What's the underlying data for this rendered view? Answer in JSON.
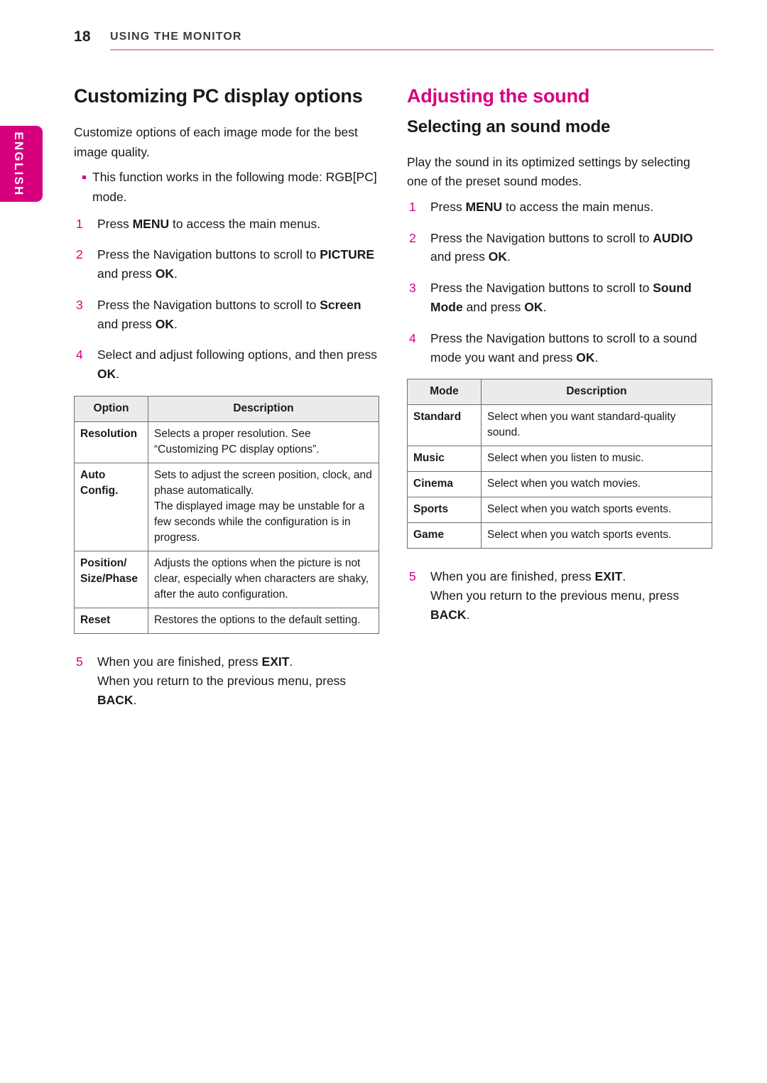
{
  "header": {
    "page_number": "18",
    "title": "USING THE MONITOR"
  },
  "language_tab": {
    "label": "ENGLISH"
  },
  "colors": {
    "accent": "#d6007f",
    "rule": "#ef8ec0",
    "table_header_bg": "#ebebeb",
    "table_border": "#6e6e6e"
  },
  "left_column": {
    "title": "Customizing PC display options",
    "intro": "Customize options of each image mode for the best image quality.",
    "notes": [
      "This function works in the following mode: RGB[PC] mode."
    ],
    "steps": [
      {
        "num": "1",
        "parts": [
          {
            "text": "Press ",
            "bold": false
          },
          {
            "text": "MENU",
            "bold": true
          },
          {
            "text": " to access the main menus.",
            "bold": false
          }
        ]
      },
      {
        "num": "2",
        "parts": [
          {
            "text": "Press the Navigation buttons to scroll to ",
            "bold": false
          },
          {
            "text": "PICTURE",
            "bold": true
          },
          {
            "text": " and press ",
            "bold": false
          },
          {
            "text": "OK",
            "bold": true
          },
          {
            "text": ".",
            "bold": false
          }
        ]
      },
      {
        "num": "3",
        "parts": [
          {
            "text": "Press the Navigation buttons to scroll to ",
            "bold": false
          },
          {
            "text": "Screen",
            "bold": true
          },
          {
            "text": " and press ",
            "bold": false
          },
          {
            "text": "OK",
            "bold": true
          },
          {
            "text": ".",
            "bold": false
          }
        ]
      },
      {
        "num": "4",
        "parts": [
          {
            "text": "Select and adjust following options, and then press ",
            "bold": false
          },
          {
            "text": "OK",
            "bold": true
          },
          {
            "text": ".",
            "bold": false
          }
        ]
      }
    ],
    "table": {
      "headers": [
        "Option",
        "Description"
      ],
      "rows": [
        {
          "key": "Resolution",
          "desc": "Selects a proper resolution. See “Customizing PC display options”."
        },
        {
          "key": "Auto Config.",
          "desc": "Sets to adjust the screen position, clock, and phase automatically.\nThe displayed image may be unstable for a few seconds while the configuration is in progress."
        },
        {
          "key": "Position/ Size/Phase",
          "desc": "Adjusts the options when the picture is not clear, especially when characters are shaky, after the auto configuration."
        },
        {
          "key": "Reset",
          "desc": "Restores the options to the default setting."
        }
      ]
    },
    "final_step": {
      "num": "5",
      "parts": [
        {
          "text": "When you are finished, press ",
          "bold": false
        },
        {
          "text": "EXIT",
          "bold": true
        },
        {
          "text": ".",
          "bold": false
        }
      ],
      "tail_parts": [
        {
          "text": "When you return to the previous menu, press ",
          "bold": false
        },
        {
          "text": "BACK",
          "bold": true
        },
        {
          "text": ".",
          "bold": false
        }
      ]
    }
  },
  "right_column": {
    "title": "Adjusting the sound",
    "subtitle": "Selecting an sound mode",
    "intro": "Play the sound in its optimized settings by selecting one of the preset sound modes.",
    "steps": [
      {
        "num": "1",
        "parts": [
          {
            "text": "Press ",
            "bold": false
          },
          {
            "text": "MENU",
            "bold": true
          },
          {
            "text": " to access the main menus.",
            "bold": false
          }
        ]
      },
      {
        "num": "2",
        "parts": [
          {
            "text": "Press the Navigation buttons to scroll to ",
            "bold": false
          },
          {
            "text": "AUDIO",
            "bold": true
          },
          {
            "text": " and press ",
            "bold": false
          },
          {
            "text": "OK",
            "bold": true
          },
          {
            "text": ".",
            "bold": false
          }
        ]
      },
      {
        "num": "3",
        "parts": [
          {
            "text": "Press the Navigation buttons to scroll to ",
            "bold": false
          },
          {
            "text": "Sound Mode",
            "bold": true
          },
          {
            "text": " and press ",
            "bold": false
          },
          {
            "text": "OK",
            "bold": true
          },
          {
            "text": ".",
            "bold": false
          }
        ]
      },
      {
        "num": "4",
        "parts": [
          {
            "text": "Press the Navigation buttons to scroll to a sound mode you want and press ",
            "bold": false
          },
          {
            "text": "OK",
            "bold": true
          },
          {
            "text": ".",
            "bold": false
          }
        ]
      }
    ],
    "table": {
      "headers": [
        "Mode",
        "Description"
      ],
      "rows": [
        {
          "key": "Standard",
          "desc": "Select when you want standard-quality sound."
        },
        {
          "key": "Music",
          "desc": "Select when you listen to music."
        },
        {
          "key": "Cinema",
          "desc": "Select when you watch movies."
        },
        {
          "key": "Sports",
          "desc": "Select when you watch sports events."
        },
        {
          "key": "Game",
          "desc": "Select when you watch sports events."
        }
      ]
    },
    "final_step": {
      "num": "5",
      "parts": [
        {
          "text": "When you are finished, press ",
          "bold": false
        },
        {
          "text": "EXIT",
          "bold": true
        },
        {
          "text": ".",
          "bold": false
        }
      ],
      "tail_parts": [
        {
          "text": "When you return to the previous menu, press ",
          "bold": false
        },
        {
          "text": "BACK",
          "bold": true
        },
        {
          "text": ".",
          "bold": false
        }
      ]
    }
  }
}
